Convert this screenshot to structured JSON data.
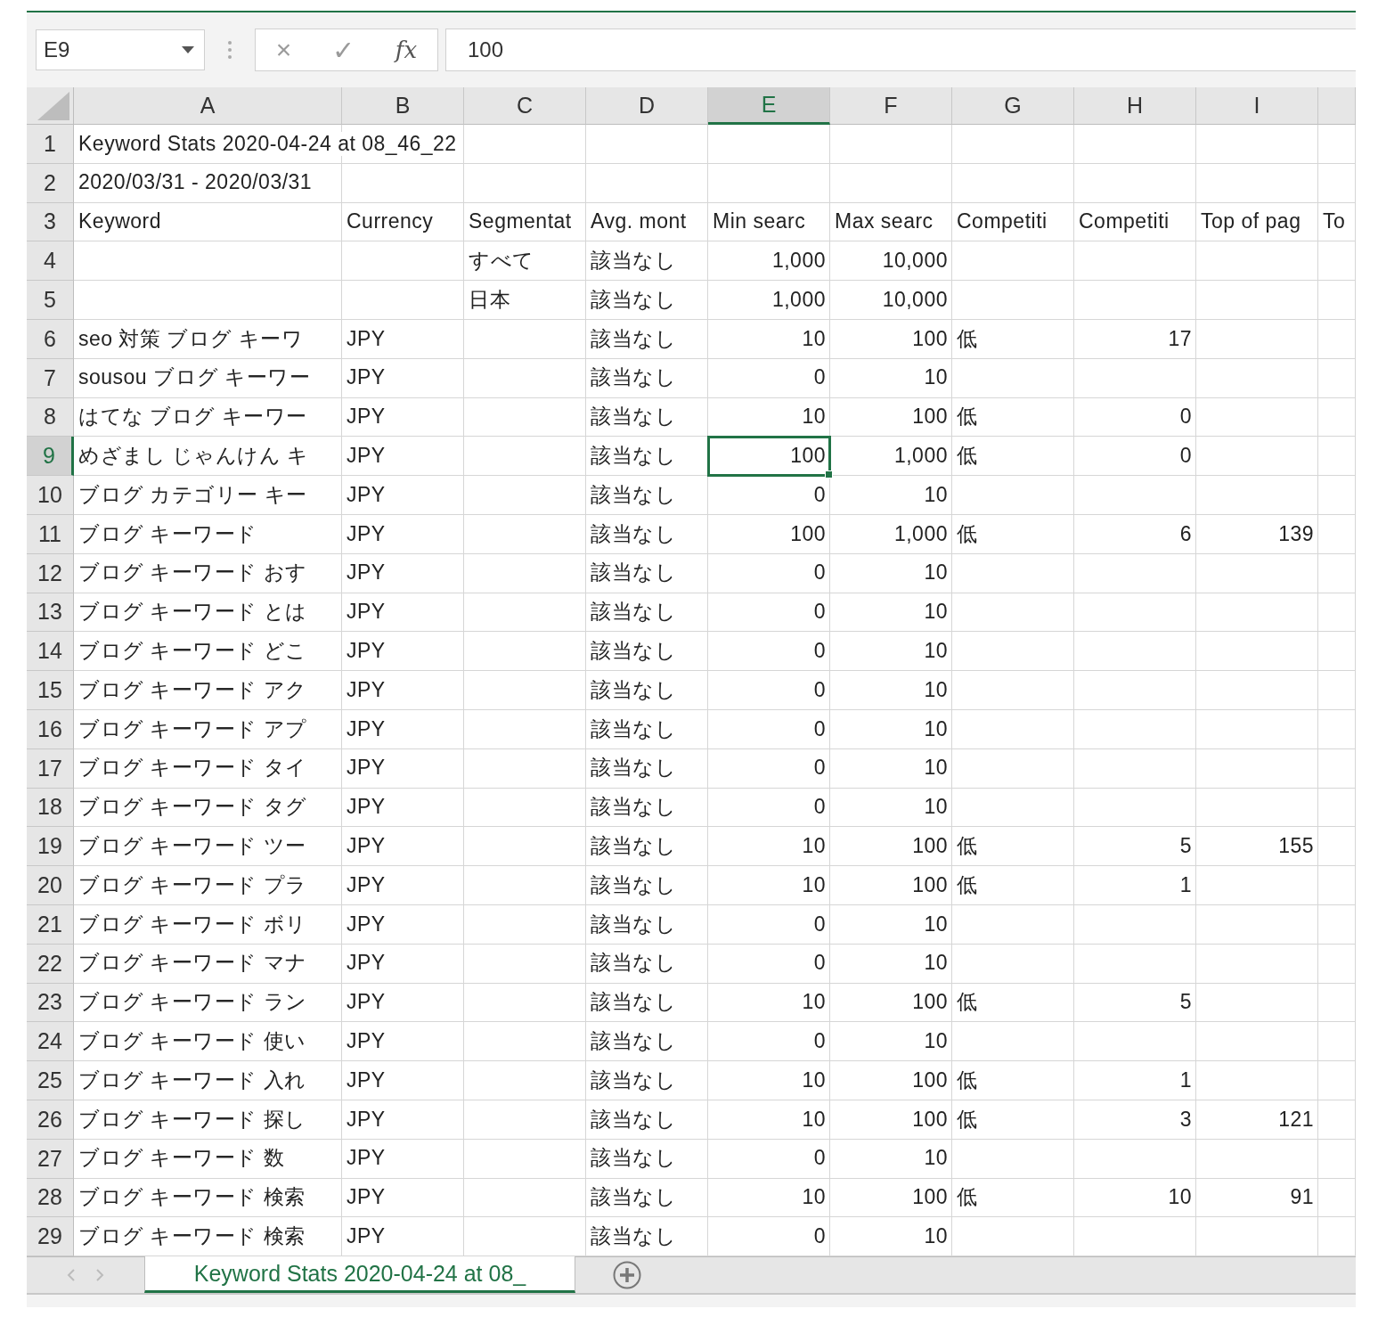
{
  "formula_bar": {
    "name_box": "E9",
    "cancel": "×",
    "enter": "✓",
    "function": "fx",
    "value": "100"
  },
  "columns": [
    {
      "letter": "A",
      "selected": false,
      "numeric": false
    },
    {
      "letter": "B",
      "selected": false,
      "numeric": false
    },
    {
      "letter": "C",
      "selected": false,
      "numeric": false
    },
    {
      "letter": "D",
      "selected": false,
      "numeric": false
    },
    {
      "letter": "E",
      "selected": true,
      "numeric": true
    },
    {
      "letter": "F",
      "selected": false,
      "numeric": true
    },
    {
      "letter": "G",
      "selected": false,
      "numeric": false
    },
    {
      "letter": "H",
      "selected": false,
      "numeric": true
    },
    {
      "letter": "I",
      "selected": false,
      "numeric": true
    },
    {
      "selected": false
    }
  ],
  "rows": [
    {
      "number": "1",
      "kind": "title",
      "selected": false,
      "cells": [
        {
          "text": "Keyword Stats 2020-04-24 at 08_46_22"
        },
        {},
        {},
        {},
        {},
        {},
        {},
        {},
        {},
        {}
      ]
    },
    {
      "number": "2",
      "kind": "title",
      "selected": false,
      "cells": [
        {
          "text": "2020/03/31 - 2020/03/31"
        },
        {},
        {},
        {},
        {},
        {},
        {},
        {},
        {},
        {}
      ]
    },
    {
      "number": "3",
      "kind": "header",
      "selected": false,
      "cells": [
        {
          "text": "Keyword"
        },
        {
          "text": "Currency"
        },
        {
          "text": "Segmentat"
        },
        {
          "text": "Avg. mont"
        },
        {
          "text": "Min searc"
        },
        {
          "text": "Max searc"
        },
        {
          "text": "Competiti"
        },
        {
          "text": "Competiti"
        },
        {
          "text": "Top of pag"
        },
        {
          "text": "To"
        }
      ]
    },
    {
      "number": "4",
      "kind": "data",
      "selected": false,
      "cells": [
        {},
        {},
        {
          "text": "すべて"
        },
        {
          "text": "該当なし"
        },
        {
          "text": "1,000"
        },
        {
          "text": "10,000"
        },
        {},
        {},
        {},
        {}
      ]
    },
    {
      "number": "5",
      "kind": "data",
      "selected": false,
      "cells": [
        {},
        {},
        {
          "text": "日本"
        },
        {
          "text": "該当なし"
        },
        {
          "text": "1,000"
        },
        {
          "text": "10,000"
        },
        {},
        {},
        {},
        {}
      ]
    },
    {
      "number": "6",
      "kind": "data",
      "selected": false,
      "cells": [
        {
          "text": "seo 対策 ブログ キーワ"
        },
        {
          "text": "JPY"
        },
        {},
        {
          "text": "該当なし"
        },
        {
          "text": "10"
        },
        {
          "text": "100"
        },
        {
          "text": "低"
        },
        {
          "text": "17"
        },
        {},
        {}
      ]
    },
    {
      "number": "7",
      "kind": "data",
      "selected": false,
      "cells": [
        {
          "text": "sousou ブログ キーワー"
        },
        {
          "text": "JPY"
        },
        {},
        {
          "text": "該当なし"
        },
        {
          "text": "0"
        },
        {
          "text": "10"
        },
        {},
        {},
        {},
        {}
      ]
    },
    {
      "number": "8",
      "kind": "data",
      "selected": false,
      "cells": [
        {
          "text": "はてな ブログ キーワー"
        },
        {
          "text": "JPY"
        },
        {},
        {
          "text": "該当なし"
        },
        {
          "text": "10"
        },
        {
          "text": "100"
        },
        {
          "text": "低"
        },
        {
          "text": "0"
        },
        {},
        {}
      ]
    },
    {
      "number": "9",
      "kind": "data",
      "selected": true,
      "cells": [
        {
          "text": "めざまし じゃんけん キ"
        },
        {
          "text": "JPY"
        },
        {},
        {
          "text": "該当なし"
        },
        {
          "text": "100"
        },
        {
          "text": "1,000"
        },
        {
          "text": "低"
        },
        {
          "text": "0"
        },
        {},
        {}
      ]
    },
    {
      "number": "10",
      "kind": "data",
      "selected": false,
      "cells": [
        {
          "text": "ブログ カテゴリー キー"
        },
        {
          "text": "JPY"
        },
        {},
        {
          "text": "該当なし"
        },
        {
          "text": "0"
        },
        {
          "text": "10"
        },
        {},
        {},
        {},
        {}
      ]
    },
    {
      "number": "11",
      "kind": "data",
      "selected": false,
      "cells": [
        {
          "text": "ブログ キーワード"
        },
        {
          "text": "JPY"
        },
        {},
        {
          "text": "該当なし"
        },
        {
          "text": "100"
        },
        {
          "text": "1,000"
        },
        {
          "text": "低"
        },
        {
          "text": "6"
        },
        {
          "text": "139"
        },
        {}
      ]
    },
    {
      "number": "12",
      "kind": "data",
      "selected": false,
      "cells": [
        {
          "text": "ブログ キーワード おす"
        },
        {
          "text": "JPY"
        },
        {},
        {
          "text": "該当なし"
        },
        {
          "text": "0"
        },
        {
          "text": "10"
        },
        {},
        {},
        {},
        {}
      ]
    },
    {
      "number": "13",
      "kind": "data",
      "selected": false,
      "cells": [
        {
          "text": "ブログ キーワード とは"
        },
        {
          "text": "JPY"
        },
        {},
        {
          "text": "該当なし"
        },
        {
          "text": "0"
        },
        {
          "text": "10"
        },
        {},
        {},
        {},
        {}
      ]
    },
    {
      "number": "14",
      "kind": "data",
      "selected": false,
      "cells": [
        {
          "text": "ブログ キーワード どこ"
        },
        {
          "text": "JPY"
        },
        {},
        {
          "text": "該当なし"
        },
        {
          "text": "0"
        },
        {
          "text": "10"
        },
        {},
        {},
        {},
        {}
      ]
    },
    {
      "number": "15",
      "kind": "data",
      "selected": false,
      "cells": [
        {
          "text": "ブログ キーワード アク"
        },
        {
          "text": "JPY"
        },
        {},
        {
          "text": "該当なし"
        },
        {
          "text": "0"
        },
        {
          "text": "10"
        },
        {},
        {},
        {},
        {}
      ]
    },
    {
      "number": "16",
      "kind": "data",
      "selected": false,
      "cells": [
        {
          "text": "ブログ キーワード アプ"
        },
        {
          "text": "JPY"
        },
        {},
        {
          "text": "該当なし"
        },
        {
          "text": "0"
        },
        {
          "text": "10"
        },
        {},
        {},
        {},
        {}
      ]
    },
    {
      "number": "17",
      "kind": "data",
      "selected": false,
      "cells": [
        {
          "text": "ブログ キーワード タイ"
        },
        {
          "text": "JPY"
        },
        {},
        {
          "text": "該当なし"
        },
        {
          "text": "0"
        },
        {
          "text": "10"
        },
        {},
        {},
        {},
        {}
      ]
    },
    {
      "number": "18",
      "kind": "data",
      "selected": false,
      "cells": [
        {
          "text": "ブログ キーワード タグ"
        },
        {
          "text": "JPY"
        },
        {},
        {
          "text": "該当なし"
        },
        {
          "text": "0"
        },
        {
          "text": "10"
        },
        {},
        {},
        {},
        {}
      ]
    },
    {
      "number": "19",
      "kind": "data",
      "selected": false,
      "cells": [
        {
          "text": "ブログ キーワード ツー"
        },
        {
          "text": "JPY"
        },
        {},
        {
          "text": "該当なし"
        },
        {
          "text": "10"
        },
        {
          "text": "100"
        },
        {
          "text": "低"
        },
        {
          "text": "5"
        },
        {
          "text": "155"
        },
        {}
      ]
    },
    {
      "number": "20",
      "kind": "data",
      "selected": false,
      "cells": [
        {
          "text": "ブログ キーワード プラ"
        },
        {
          "text": "JPY"
        },
        {},
        {
          "text": "該当なし"
        },
        {
          "text": "10"
        },
        {
          "text": "100"
        },
        {
          "text": "低"
        },
        {
          "text": "1"
        },
        {},
        {}
      ]
    },
    {
      "number": "21",
      "kind": "data",
      "selected": false,
      "cells": [
        {
          "text": "ブログ キーワード ボリ"
        },
        {
          "text": "JPY"
        },
        {},
        {
          "text": "該当なし"
        },
        {
          "text": "0"
        },
        {
          "text": "10"
        },
        {},
        {},
        {},
        {}
      ]
    },
    {
      "number": "22",
      "kind": "data",
      "selected": false,
      "cells": [
        {
          "text": "ブログ キーワード マナ"
        },
        {
          "text": "JPY"
        },
        {},
        {
          "text": "該当なし"
        },
        {
          "text": "0"
        },
        {
          "text": "10"
        },
        {},
        {},
        {},
        {}
      ]
    },
    {
      "number": "23",
      "kind": "data",
      "selected": false,
      "cells": [
        {
          "text": "ブログ キーワード ラン"
        },
        {
          "text": "JPY"
        },
        {},
        {
          "text": "該当なし"
        },
        {
          "text": "10"
        },
        {
          "text": "100"
        },
        {
          "text": "低"
        },
        {
          "text": "5"
        },
        {},
        {}
      ]
    },
    {
      "number": "24",
      "kind": "data",
      "selected": false,
      "cells": [
        {
          "text": "ブログ キーワード 使い"
        },
        {
          "text": "JPY"
        },
        {},
        {
          "text": "該当なし"
        },
        {
          "text": "0"
        },
        {
          "text": "10"
        },
        {},
        {},
        {},
        {}
      ]
    },
    {
      "number": "25",
      "kind": "data",
      "selected": false,
      "cells": [
        {
          "text": "ブログ キーワード 入れ"
        },
        {
          "text": "JPY"
        },
        {},
        {
          "text": "該当なし"
        },
        {
          "text": "10"
        },
        {
          "text": "100"
        },
        {
          "text": "低"
        },
        {
          "text": "1"
        },
        {},
        {}
      ]
    },
    {
      "number": "26",
      "kind": "data",
      "selected": false,
      "cells": [
        {
          "text": "ブログ キーワード 探し"
        },
        {
          "text": "JPY"
        },
        {},
        {
          "text": "該当なし"
        },
        {
          "text": "10"
        },
        {
          "text": "100"
        },
        {
          "text": "低"
        },
        {
          "text": "3"
        },
        {
          "text": "121"
        },
        {}
      ]
    },
    {
      "number": "27",
      "kind": "data",
      "selected": false,
      "cells": [
        {
          "text": "ブログ キーワード 数"
        },
        {
          "text": "JPY"
        },
        {},
        {
          "text": "該当なし"
        },
        {
          "text": "0"
        },
        {
          "text": "10"
        },
        {},
        {},
        {},
        {}
      ]
    },
    {
      "number": "28",
      "kind": "data",
      "selected": false,
      "cells": [
        {
          "text": "ブログ キーワード 検索"
        },
        {
          "text": "JPY"
        },
        {},
        {
          "text": "該当なし"
        },
        {
          "text": "10"
        },
        {
          "text": "100"
        },
        {
          "text": "低"
        },
        {
          "text": "10"
        },
        {
          "text": "91"
        },
        {}
      ]
    },
    {
      "number": "29",
      "kind": "data",
      "selected": false,
      "cells": [
        {
          "text": "ブログ キーワード 検索"
        },
        {
          "text": "JPY"
        },
        {},
        {
          "text": "該当なし"
        },
        {
          "text": "0"
        },
        {
          "text": "10"
        },
        {},
        {},
        {},
        {}
      ]
    }
  ],
  "sheet_tabs": [
    {
      "label": "Keyword Stats 2020-04-24 at 08_",
      "selected": true
    }
  ]
}
